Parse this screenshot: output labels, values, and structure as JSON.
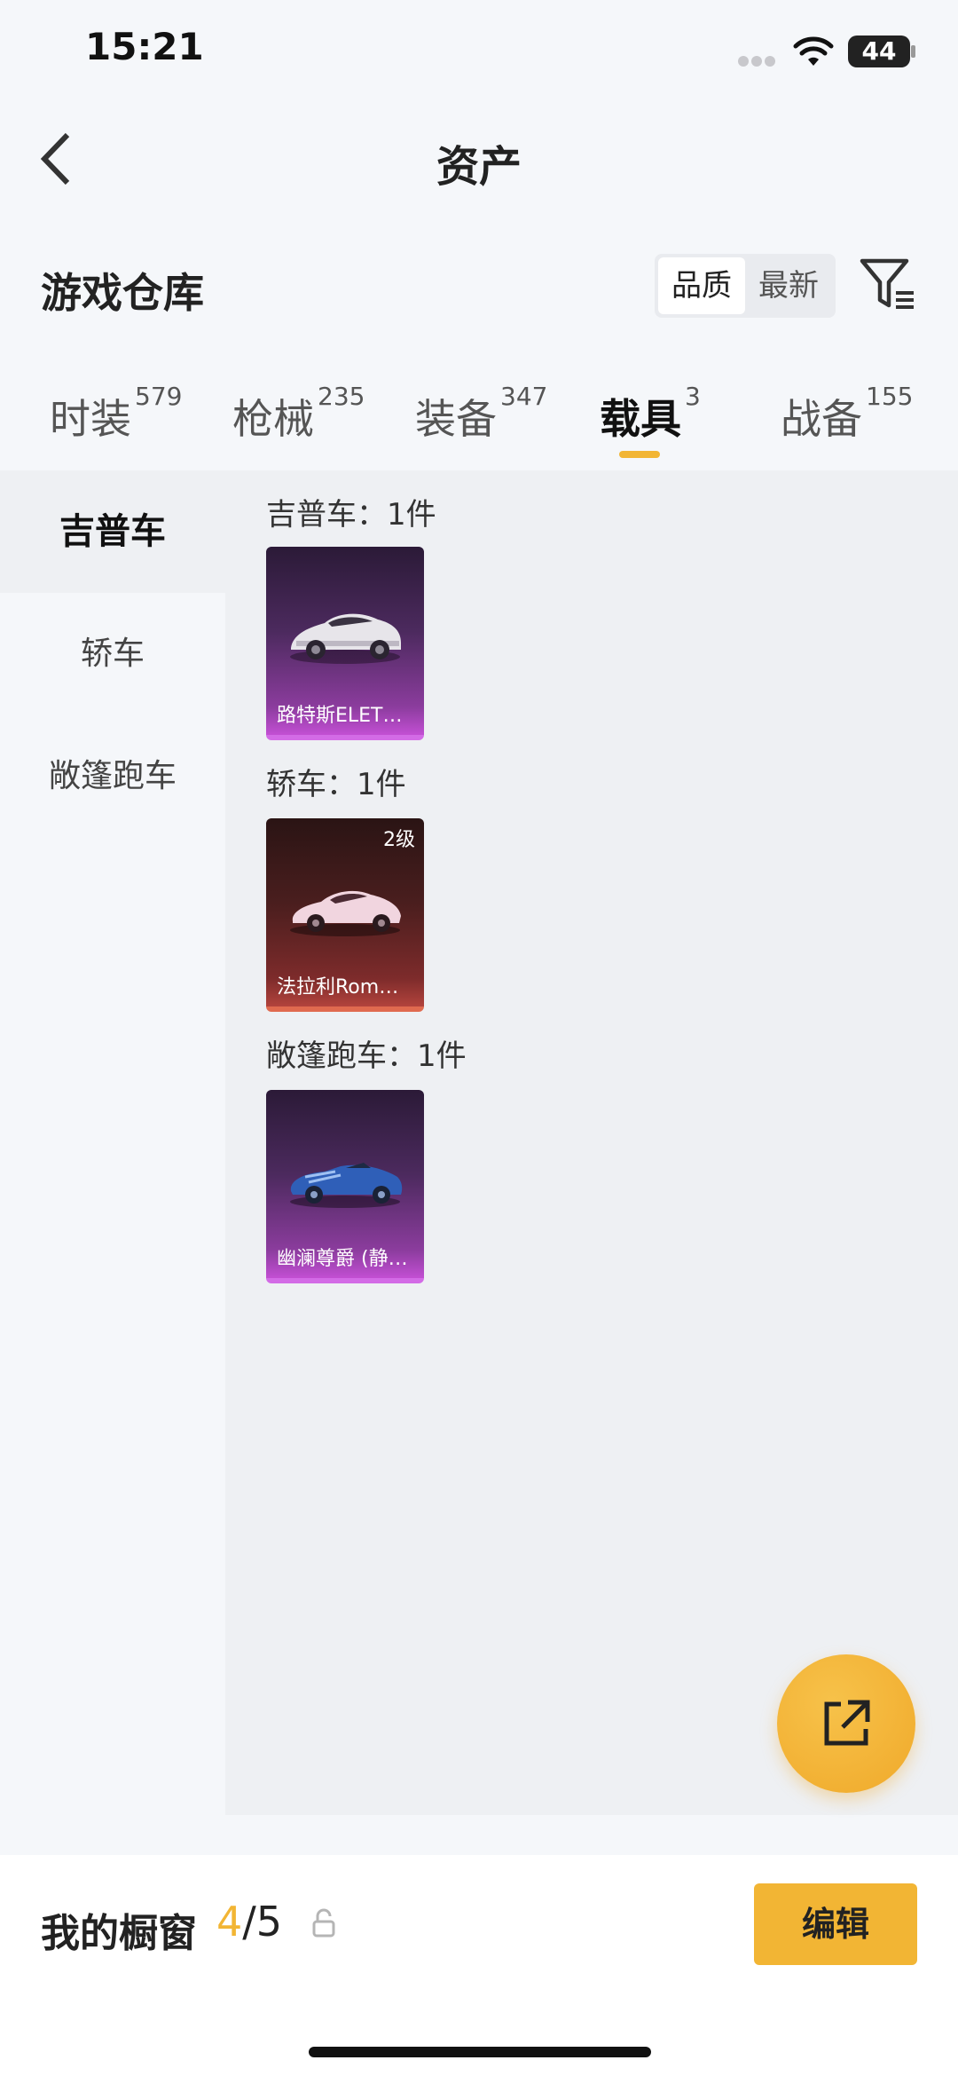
{
  "status_bar": {
    "time": "15:21",
    "battery": "44"
  },
  "nav": {
    "title": "资产"
  },
  "section": {
    "title": "游戏仓库"
  },
  "sort": {
    "options": [
      "品质",
      "最新"
    ],
    "active": "品质"
  },
  "tabs": [
    {
      "label": "时装",
      "count": "579"
    },
    {
      "label": "枪械",
      "count": "235"
    },
    {
      "label": "装备",
      "count": "347"
    },
    {
      "label": "载具",
      "count": "3"
    },
    {
      "label": "战备",
      "count": "155"
    }
  ],
  "active_tab": "载具",
  "sidebar": {
    "items": [
      "吉普车",
      "轿车",
      "敞篷跑车"
    ],
    "active": "吉普车"
  },
  "groups": [
    {
      "label": "吉普车：1件",
      "items": [
        {
          "name": "路特斯ELET…",
          "rarity_color": "#c24fd3"
        }
      ]
    },
    {
      "label": "轿车：1件",
      "items": [
        {
          "name": "法拉利Rom…",
          "level": "2级",
          "rarity_color": "#e06a4f"
        }
      ]
    },
    {
      "label": "敞篷跑车：1件",
      "items": [
        {
          "name": "幽澜尊爵 (静…",
          "rarity_color": "#c24fd3"
        }
      ]
    }
  ],
  "bottom_bar": {
    "showcase_label": "我的橱窗",
    "showcase_current": "4",
    "showcase_total": "/5",
    "edit_label": "编辑"
  },
  "colors": {
    "accent": "#f2b534",
    "purple_rarity": "#c24fd3",
    "red_rarity": "#e06a4f"
  }
}
